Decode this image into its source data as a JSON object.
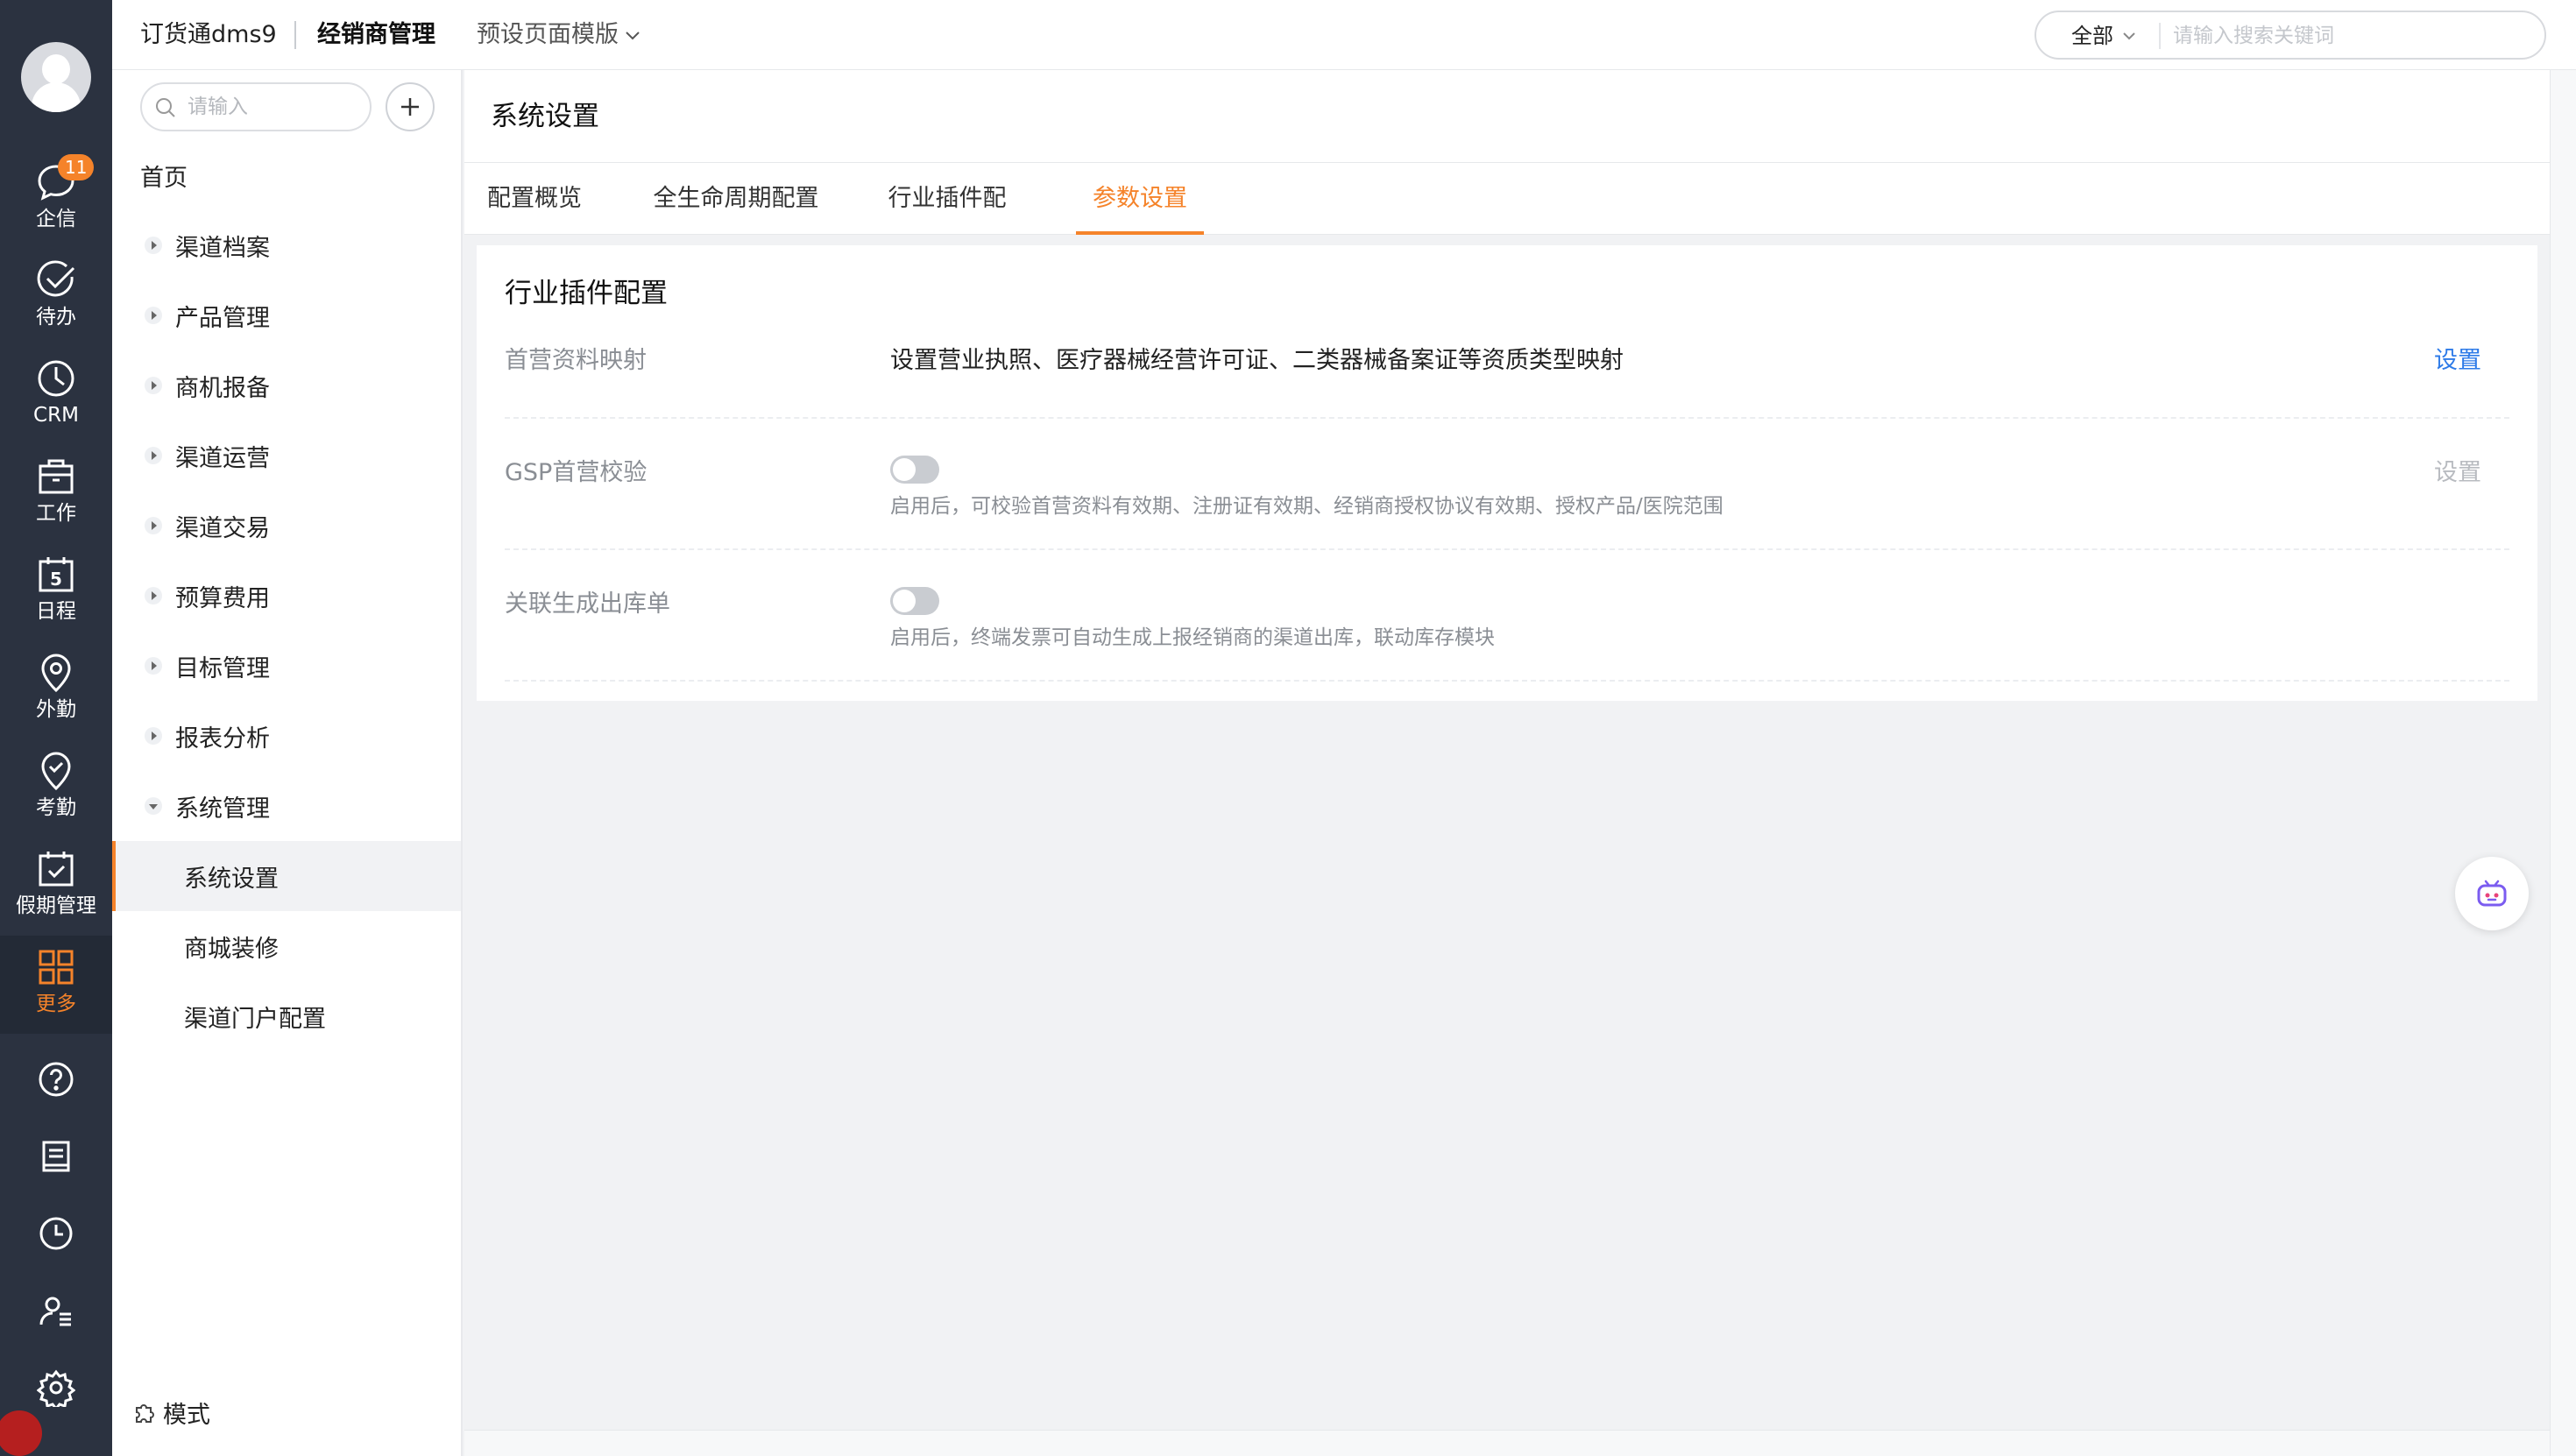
{
  "rail": {
    "items": [
      {
        "label": "企信",
        "icon": "chat-icon",
        "badge": "11"
      },
      {
        "label": "待办",
        "icon": "check-circle-icon"
      },
      {
        "label": "CRM",
        "icon": "clock-pie-icon"
      },
      {
        "label": "工作",
        "icon": "briefcase-icon"
      },
      {
        "label": "日程",
        "icon": "calendar-icon",
        "day": "5"
      },
      {
        "label": "外勤",
        "icon": "location-pin-icon"
      },
      {
        "label": "考勤",
        "icon": "checkin-pin-icon"
      },
      {
        "label": "假期管理",
        "icon": "calendar-check-icon"
      },
      {
        "label": "更多",
        "icon": "grid-icon"
      }
    ],
    "tools": [
      "help-icon",
      "notebook-icon",
      "history-icon",
      "contacts-icon",
      "settings-icon"
    ]
  },
  "header": {
    "app_name": "订货通dms9",
    "module": "经销商管理",
    "template_label": "预设页面模版",
    "search_scope": "全部",
    "search_placeholder": "请输入搜索关键词"
  },
  "menu": {
    "search_placeholder": "请输入",
    "home": "首页",
    "groups": [
      "渠道档案",
      "产品管理",
      "商机报备",
      "渠道运营",
      "渠道交易",
      "预算费用",
      "目标管理",
      "报表分析",
      "系统管理"
    ],
    "subitems": [
      "系统设置",
      "商城装修",
      "渠道门户配置"
    ],
    "mode_label": "模式"
  },
  "page": {
    "title": "系统设置",
    "tabs": [
      "配置概览",
      "全生命周期配置",
      "行业插件配置",
      "参数设置"
    ],
    "active_tab": "参数设置"
  },
  "card": {
    "title": "行业插件配置",
    "rows": [
      {
        "label": "首营资料映射",
        "desc": "设置营业执照、医疗器械经营许可证、二类器械备案证等资质类型映射",
        "action": "设置"
      },
      {
        "label": "GSP首营校验",
        "hint": "启用后，可校验首营资料有效期、注册证有效期、经销商授权协议有效期、授权产品/医院范围",
        "action": "设置",
        "enabled": false
      },
      {
        "label": "关联生成出库单",
        "hint": "启用后，终端发票可自动生成上报经销商的渠道出库，联动库存模块",
        "enabled": false
      }
    ]
  },
  "colors": {
    "accent": "#f5832a",
    "link": "#2e7be8",
    "rail_bg": "#2b3240",
    "disabled": "#b8bbc0"
  },
  "fab": {
    "icon": "ai-bot-icon"
  }
}
